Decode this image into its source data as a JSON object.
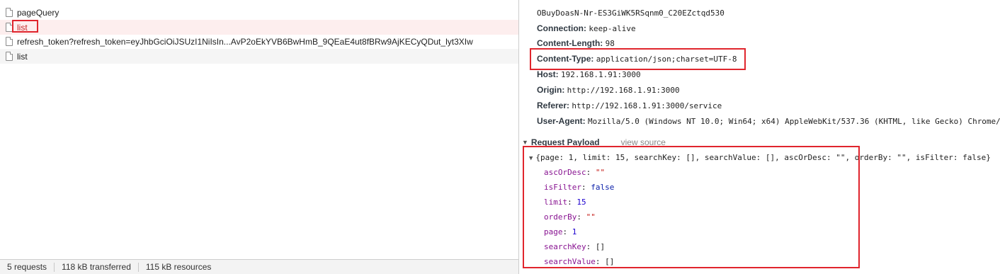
{
  "requests": [
    {
      "name": "pageQuery",
      "selected": false,
      "alt": false
    },
    {
      "name": "list",
      "selected": true,
      "alt": false
    },
    {
      "name": "refresh_token?refresh_token=eyJhbGciOiJSUzI1NiIsIn...AvP2oEkYVB6BwHmB_9QEaE4ut8fBRw9AjKECyQDut_lyt3XIw",
      "selected": false,
      "alt": false
    },
    {
      "name": "list",
      "selected": false,
      "alt": true
    }
  ],
  "status_bar": {
    "requests": "5 requests",
    "transferred": "118 kB transferred",
    "resources": "115 kB resources"
  },
  "headers": {
    "token_tail": "OBuyDoasN-Nr-ES3GiWK5RSqnm0_C20EZctqd530",
    "connection": {
      "key": "Connection:",
      "value": "keep-alive"
    },
    "content_length": {
      "key": "Content-Length:",
      "value": "98"
    },
    "content_type": {
      "key": "Content-Type:",
      "value": "application/json;charset=UTF-8"
    },
    "host": {
      "key": "Host:",
      "value": "192.168.1.91:3000"
    },
    "origin": {
      "key": "Origin:",
      "value": "http://192.168.1.91:3000"
    },
    "referer": {
      "key": "Referer:",
      "value": "http://192.168.1.91:3000/service"
    },
    "user_agent": {
      "key": "User-Agent:",
      "value": "Mozilla/5.0 (Windows NT 10.0; Win64; x64) AppleWebKit/537.36 (KHTML, like Gecko) Chrome/"
    }
  },
  "payload": {
    "section_title": "Request Payload",
    "view_source": "view source",
    "summary": "{page: 1, limit: 15, searchKey: [], searchValue: [], ascOrDesc: \"\", orderBy: \"\", isFilter: false}",
    "fields": [
      {
        "key": "ascOrDesc",
        "value": "\"\"",
        "type": "string"
      },
      {
        "key": "isFilter",
        "value": "false",
        "type": "bool"
      },
      {
        "key": "limit",
        "value": "15",
        "type": "number"
      },
      {
        "key": "orderBy",
        "value": "\"\"",
        "type": "string"
      },
      {
        "key": "page",
        "value": "1",
        "type": "number"
      },
      {
        "key": "searchKey",
        "value": "[]",
        "type": "plain"
      },
      {
        "key": "searchValue",
        "value": "[]",
        "type": "plain"
      }
    ]
  },
  "colors": {
    "highlight_red": "#e0252d",
    "selected_row": "#fdeeee",
    "json_key": "#881391",
    "json_string": "#c41a16",
    "json_number": "#1c00cf",
    "json_bool": "#0d22aa"
  },
  "icons": {
    "request_file": "file-icon",
    "expand_triangle": "triangle-down-icon"
  }
}
